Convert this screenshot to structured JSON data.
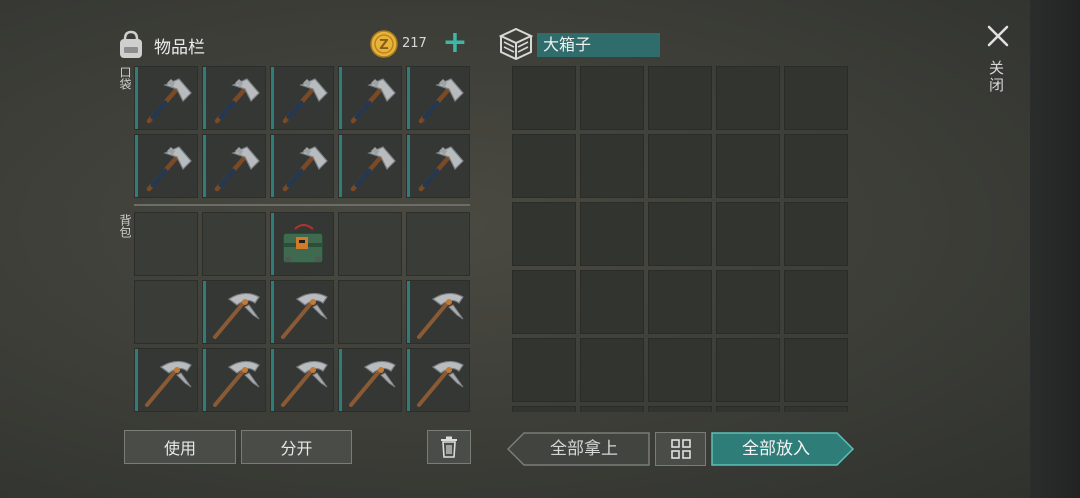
{
  "inventory": {
    "title": "物品栏",
    "coins": "217",
    "add_coins_icon": "plus-icon",
    "pocket_label": "口袋",
    "backpack_label": "背包",
    "pocket_slots": [
      "axe",
      "axe",
      "axe",
      "axe",
      "axe",
      "axe",
      "axe",
      "axe",
      "axe",
      "axe"
    ],
    "backpack_slots": [
      "empty",
      "empty",
      "toolbox",
      "empty",
      "empty",
      "empty",
      "pickaxe",
      "pickaxe",
      "empty",
      "pickaxe",
      "pickaxe",
      "pickaxe",
      "pickaxe",
      "pickaxe",
      "pickaxe"
    ],
    "use_label": "使用",
    "split_label": "分开",
    "trash_icon": "trash-icon"
  },
  "container": {
    "name": "大箱子",
    "icon": "box-stack-icon",
    "take_all_label": "全部拿上",
    "sort_icon": "grid-icon",
    "put_all_label": "全部放入"
  },
  "close": {
    "icon": "close-icon",
    "label": "关闭"
  },
  "colors": {
    "accent": "#2f7d78",
    "accent_bright": "#3db8a6",
    "name_bg": "#2f6d6c",
    "coin": "#e8b33a"
  }
}
